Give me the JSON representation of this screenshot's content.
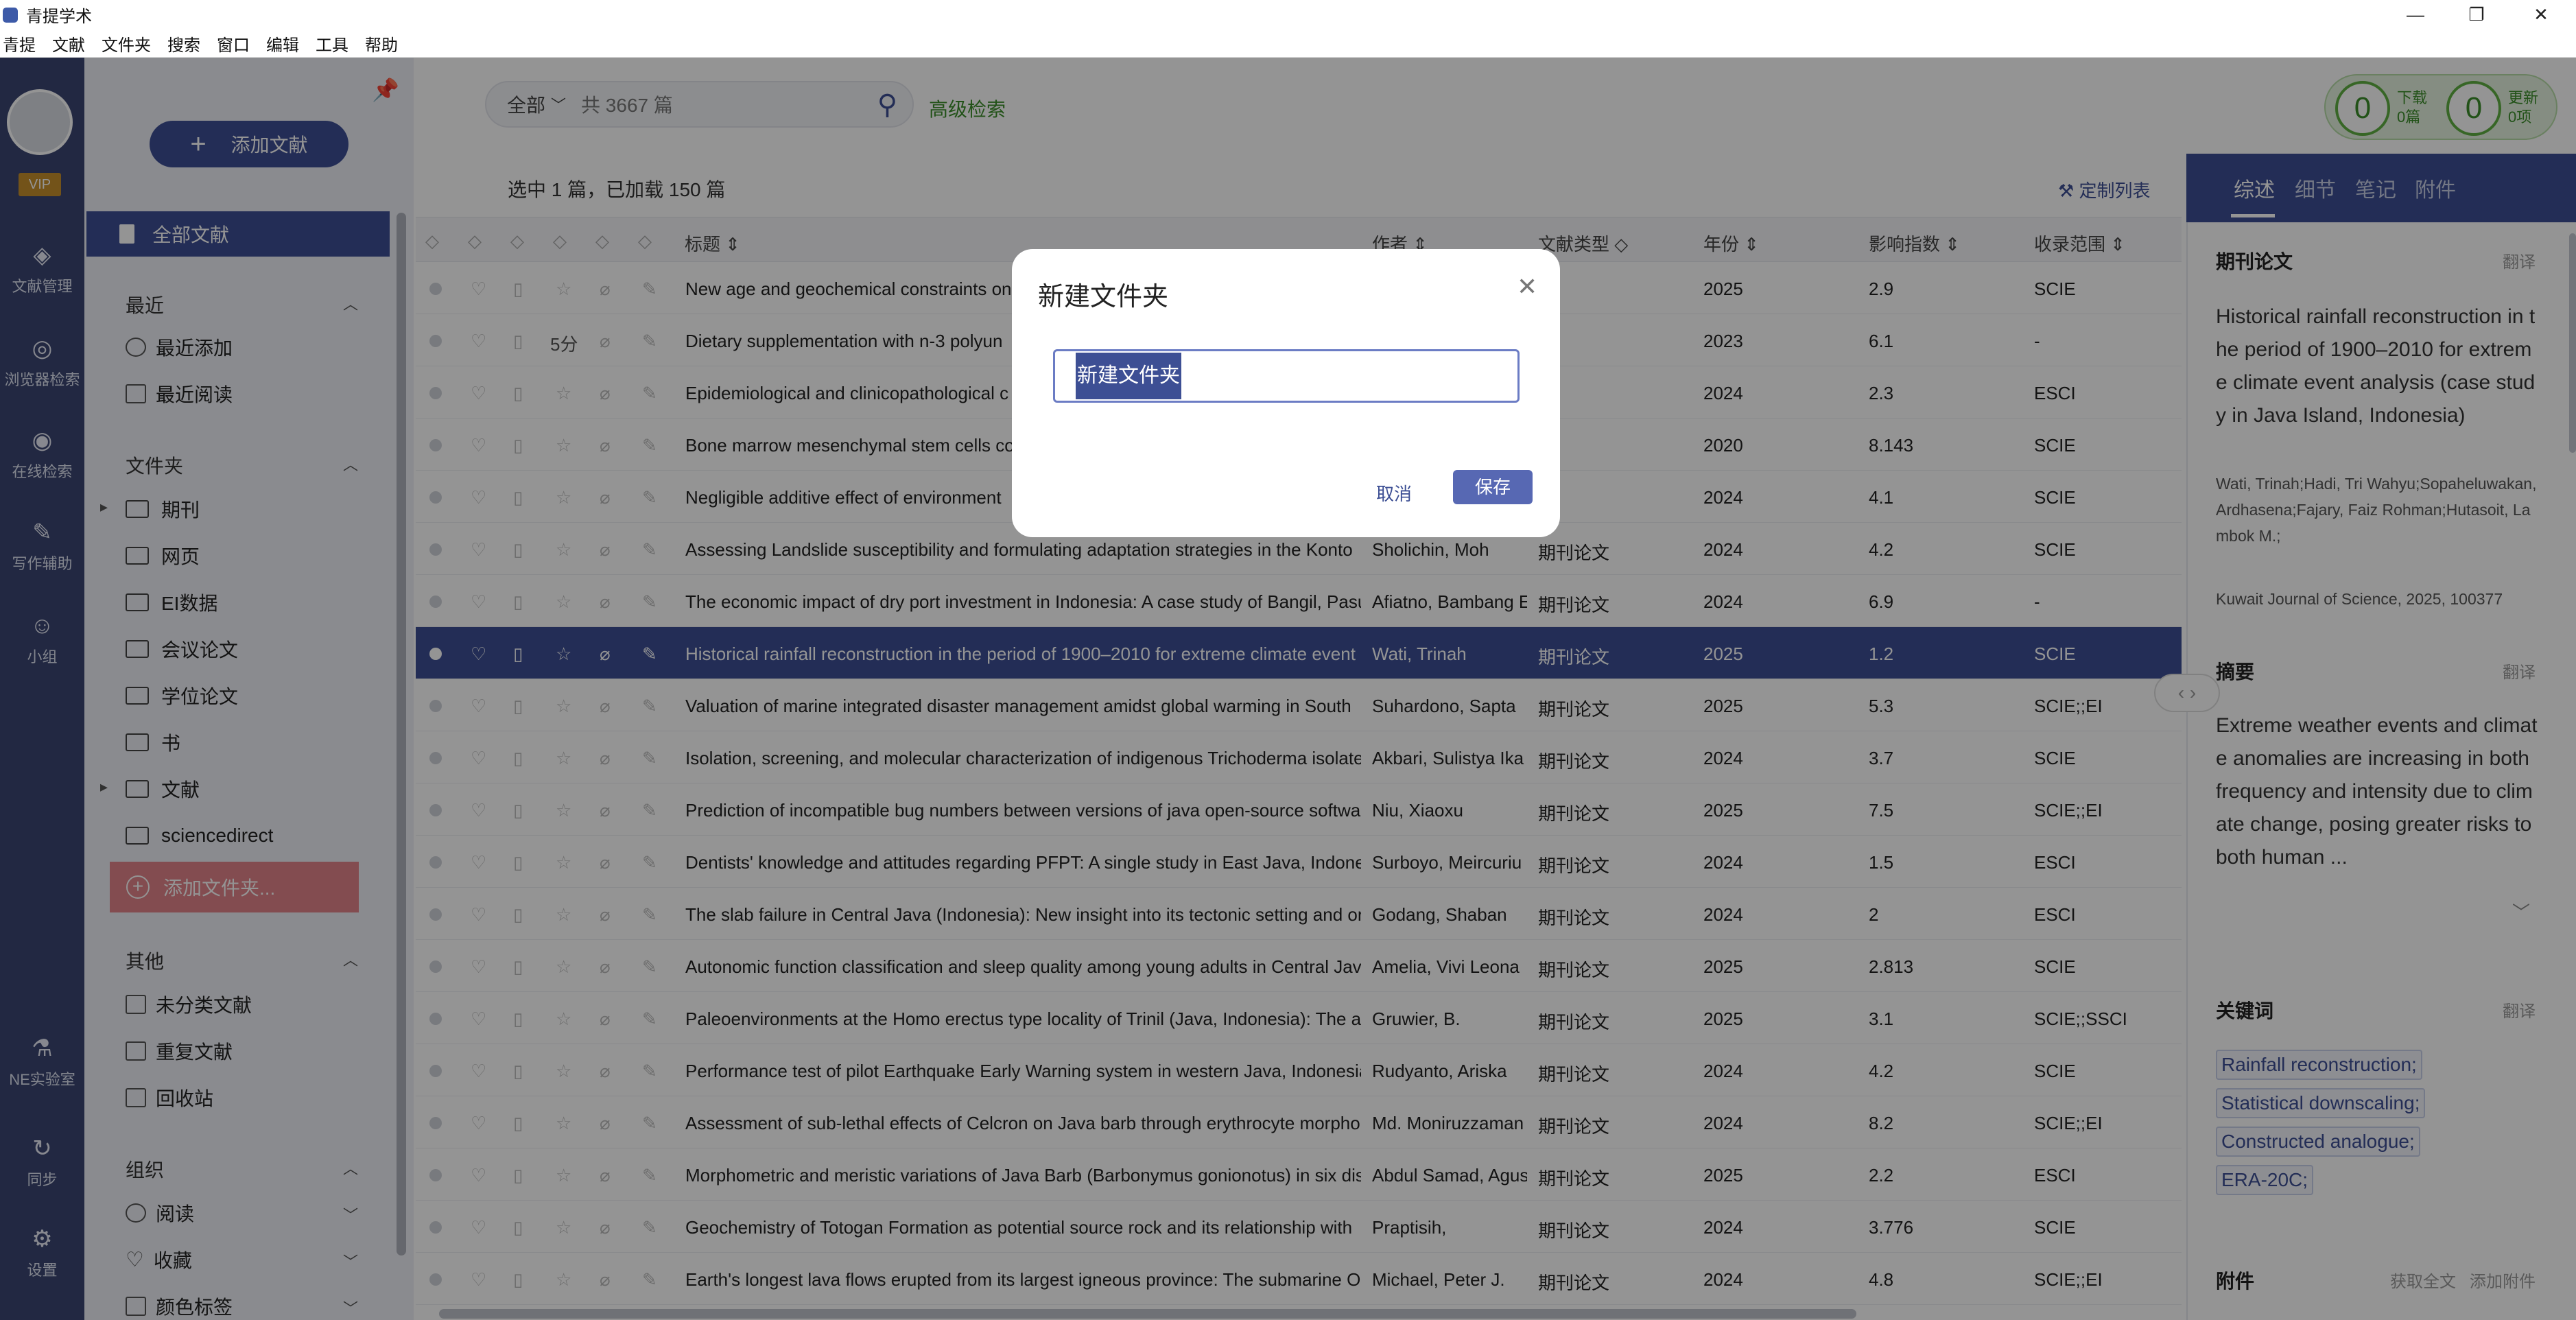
{
  "app": {
    "title": "青提学术"
  },
  "menu": [
    "青提",
    "文献",
    "文件夹",
    "搜索",
    "窗口",
    "编辑",
    "工具",
    "帮助"
  ],
  "rail": {
    "vip": "VIP",
    "items": [
      {
        "label": "文献管理",
        "icon": "library-icon"
      },
      {
        "label": "浏览器检索",
        "icon": "browser-search-icon"
      },
      {
        "label": "在线检索",
        "icon": "eye-icon"
      },
      {
        "label": "写作辅助",
        "icon": "writing-icon"
      },
      {
        "label": "小组",
        "icon": "group-icon"
      },
      {
        "label": "NE实验室",
        "icon": "flask-icon"
      },
      {
        "label": "同步",
        "icon": "sync-icon"
      },
      {
        "label": "设置",
        "icon": "gear-icon"
      }
    ]
  },
  "sidebar": {
    "add_doc": "添加文献",
    "all_docs": "全部文献",
    "recent_title": "最近",
    "recent": [
      "最近添加",
      "最近阅读"
    ],
    "folders_title": "文件夹",
    "folders": [
      "期刊",
      "网页",
      "EI数据",
      "会议论文",
      "学位论文",
      "书",
      "文献",
      "sciencedirect"
    ],
    "add_folder": "添加文件夹...",
    "other_title": "其他",
    "other": [
      "未分类文献",
      "重复文献",
      "回收站"
    ],
    "org_title": "组织",
    "org": [
      "阅读",
      "收藏",
      "颜色标签"
    ]
  },
  "search": {
    "scope": "全部",
    "placeholder": "共 3667 篇",
    "advanced": "高级检索"
  },
  "status": {
    "download_count": "0",
    "download_label": "下载",
    "download_unit": "0篇",
    "update_count": "0",
    "update_label": "更新",
    "update_unit": "0项"
  },
  "list": {
    "selected_info": "选中 1 篇，已加载 150 篇",
    "custom_list": "定制列表",
    "headers": {
      "title": "标题",
      "author": "作者",
      "type": "文献类型",
      "year": "年份",
      "impact": "影响指数",
      "scope": "收录范围"
    },
    "rows": [
      {
        "title": "New age and geochemical constraints on",
        "author": "",
        "type": "",
        "year": "2025",
        "impact": "2.9",
        "scope": "SCIE"
      },
      {
        "title": "Dietary supplementation with n-3 polyun",
        "author": "",
        "type": "",
        "year": "2023",
        "impact": "6.1",
        "scope": "-",
        "score": "5分"
      },
      {
        "title": "Epidemiological and clinicopathological c",
        "author": "",
        "type": "",
        "year": "2024",
        "impact": "2.3",
        "scope": "ESCI"
      },
      {
        "title": "Bone marrow mesenchymal stem cells co",
        "author": "",
        "type": "",
        "year": "2020",
        "impact": "8.143",
        "scope": "SCIE"
      },
      {
        "title": "Negligible additive effect of environment",
        "author": "",
        "type": "",
        "year": "2024",
        "impact": "4.1",
        "scope": "SCIE"
      },
      {
        "title": "Assessing Landslide susceptibility and formulating adaptation strategies in the Konto",
        "author": "Sholichin, Moh",
        "type": "期刊论文",
        "year": "2024",
        "impact": "4.2",
        "scope": "SCIE"
      },
      {
        "title": "The economic impact of dry port investment in Indonesia: A case study of Bangil, Pasu",
        "author": "Afiatno, Bambang E",
        "type": "期刊论文",
        "year": "2024",
        "impact": "6.9",
        "scope": "-"
      },
      {
        "title": "Historical rainfall reconstruction in the period of 1900–2010 for extreme climate event",
        "author": "Wati, Trinah",
        "type": "期刊论文",
        "year": "2025",
        "impact": "1.2",
        "scope": "SCIE"
      },
      {
        "title": "Valuation of marine integrated disaster management amidst global warming in South",
        "author": "Suhardono, Sapta",
        "type": "期刊论文",
        "year": "2025",
        "impact": "5.3",
        "scope": "SCIE;;EI"
      },
      {
        "title": "Isolation, screening, and molecular characterization of indigenous Trichoderma isolate",
        "author": "Akbari, Sulistya Ika",
        "type": "期刊论文",
        "year": "2024",
        "impact": "3.7",
        "scope": "SCIE"
      },
      {
        "title": "Prediction of incompatible bug numbers between versions of java open-source softwa",
        "author": "Niu, Xiaoxu",
        "type": "期刊论文",
        "year": "2025",
        "impact": "7.5",
        "scope": "SCIE;;EI"
      },
      {
        "title": "Dentists' knowledge and attitudes regarding PFPT: A single study in East Java, Indone",
        "author": "Surboyo, Meircuriu",
        "type": "期刊论文",
        "year": "2024",
        "impact": "1.5",
        "scope": "ESCI"
      },
      {
        "title": "The slab failure in Central Java (Indonesia): New insight into its tectonic setting and or",
        "author": "Godang, Shaban",
        "type": "期刊论文",
        "year": "2024",
        "impact": "2",
        "scope": "ESCI"
      },
      {
        "title": "Autonomic function classification and sleep quality among young adults in Central Jav",
        "author": "Amelia, Vivi Leona",
        "type": "期刊论文",
        "year": "2025",
        "impact": "2.813",
        "scope": "SCIE"
      },
      {
        "title": "Paleoenvironments at the Homo erectus type locality of Trinil (Java, Indonesia): The ar",
        "author": "Gruwier, B.",
        "type": "期刊论文",
        "year": "2025",
        "impact": "3.1",
        "scope": "SCIE;;SSCI"
      },
      {
        "title": "Performance test of pilot Earthquake Early Warning system in western Java, Indonesia",
        "author": "Rudyanto, Ariska",
        "type": "期刊论文",
        "year": "2024",
        "impact": "4.2",
        "scope": "SCIE"
      },
      {
        "title": "Assessment of sub-lethal effects of Celcron on Java barb through erythrocyte morpho",
        "author": "Md. Moniruzzaman",
        "type": "期刊论文",
        "year": "2024",
        "impact": "8.2",
        "scope": "SCIE;;EI"
      },
      {
        "title": "Morphometric and meristic variations of Java Barb (Barbonymus gonionotus) in six dis",
        "author": "Abdul Samad, Agus",
        "type": "期刊论文",
        "year": "2025",
        "impact": "2.2",
        "scope": "ESCI"
      },
      {
        "title": "Geochemistry of Totogan Formation as potential source rock and its relationship with",
        "author": "Praptisih,",
        "type": "期刊论文",
        "year": "2024",
        "impact": "3.776",
        "scope": "SCIE"
      },
      {
        "title": "Earth's longest lava flows erupted from its largest igneous province: The submarine O",
        "author": "Michael, Peter J.",
        "type": "期刊论文",
        "year": "2024",
        "impact": "4.8",
        "scope": "SCIE;;EI"
      }
    ]
  },
  "right": {
    "tabs": [
      "综述",
      "细节",
      "笔记",
      "附件"
    ],
    "type_head": "期刊论文",
    "translate": "翻译",
    "paper_title": "Historical rainfall reconstruction in the period of 1900–2010 for extreme climate event analysis (case study in Java Island, Indonesia)",
    "authors": "Wati, Trinah;Hadi, Tri Wahyu;Sopaheluwakan, Ardhasena;Fajary, Faiz Rohman;Hutasoit, Lambok M.;",
    "journal": "Kuwait Journal of Science, 2025, 100377",
    "abstract_head": "摘要",
    "abstract": "Extreme weather events and climate anomalies are increasing in both frequency and intensity due to climate change, posing greater risks to both human ...",
    "keywords_head": "关键词",
    "keywords": [
      "Rainfall reconstruction;",
      "Statistical downscaling;",
      "Constructed analogue;",
      "ERA-20C;"
    ],
    "attach_head": "附件",
    "get_fulltext": "获取全文",
    "add_attach": "添加附件"
  },
  "dialog": {
    "title": "新建文件夹",
    "input_value": "新建文件夹",
    "cancel": "取消",
    "save": "保存"
  }
}
